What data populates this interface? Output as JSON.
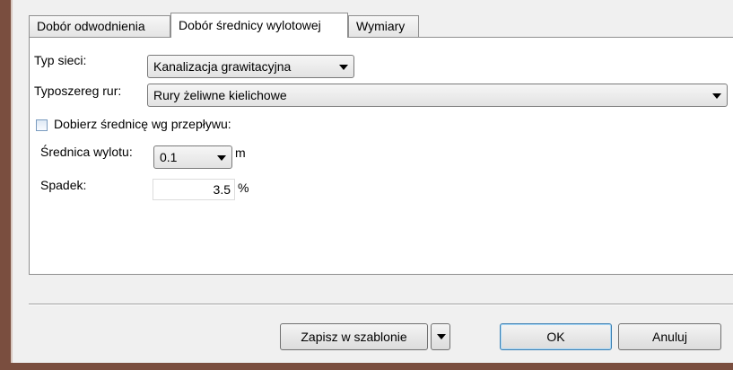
{
  "tabs": [
    {
      "label": "Dobór odwodnienia"
    },
    {
      "label": "Dobór średnicy wylotowej"
    },
    {
      "label": "Wymiary"
    }
  ],
  "form": {
    "network_type": {
      "label": "Typ sieci:",
      "value": "Kanalizacja grawitacyjna"
    },
    "pipe_series": {
      "label": "Typoszereg rur:",
      "value": "Rury żeliwne kielichowe"
    },
    "select_by_flow": {
      "label": "Dobierz średnicę wg przepływu:",
      "checked": false
    },
    "outlet_diameter": {
      "label": "Średnica wylotu:",
      "value": "0.1",
      "unit": "m"
    },
    "slope": {
      "label": "Spadek:",
      "value": "3.5",
      "unit": "%"
    }
  },
  "footer": {
    "save_template_label": "Zapisz w szablonie",
    "ok_label": "OK",
    "cancel_label": "Anuluj"
  },
  "colors": {
    "frame": "#7a4e3f",
    "panel": "#ffffff",
    "background": "#f0f0f0"
  },
  "icons": [
    "chevron-down-icon"
  ]
}
